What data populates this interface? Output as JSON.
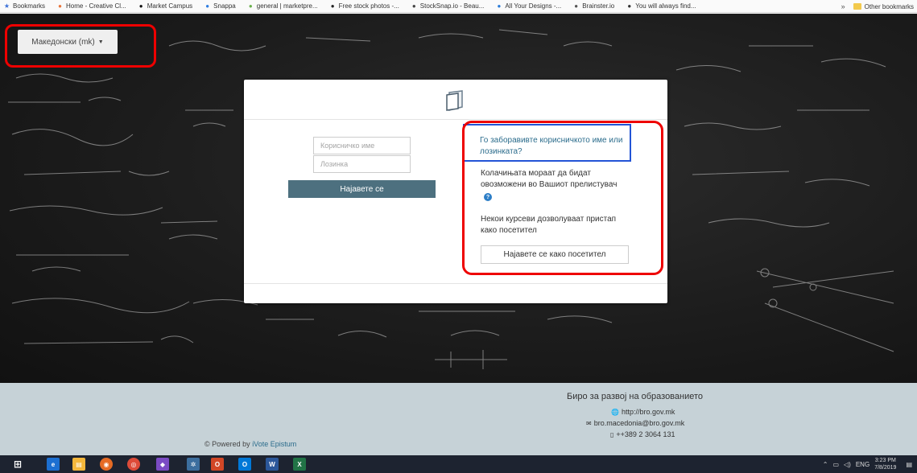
{
  "bookmarks": {
    "items": [
      {
        "label": "Bookmarks",
        "icon": "star-icon",
        "color": "#3a6fd8"
      },
      {
        "label": "Home - Creative Cl...",
        "icon": "creative-icon",
        "color": "#e8743b"
      },
      {
        "label": "Market Campus",
        "icon": "market-icon",
        "color": "#111111"
      },
      {
        "label": "Snappa",
        "icon": "snappa-icon",
        "color": "#2f7de1"
      },
      {
        "label": "general | marketpre...",
        "icon": "slack-icon",
        "color": "#6ab04c"
      },
      {
        "label": "Free stock photos -...",
        "icon": "pexels-icon",
        "color": "#222222"
      },
      {
        "label": "StockSnap.io - Beau...",
        "icon": "camera-icon",
        "color": "#444444"
      },
      {
        "label": "All Your Designs -...",
        "icon": "canva-icon",
        "color": "#2a7bd8"
      },
      {
        "label": "Brainster.io",
        "icon": "brainster-icon",
        "color": "#555555"
      },
      {
        "label": "You will always find...",
        "icon": "page-icon",
        "color": "#333333"
      }
    ],
    "overflow": "»",
    "other": "Other bookmarks"
  },
  "lang": {
    "label": "Македонски (mk)"
  },
  "login": {
    "username_placeholder": "Корисничко име",
    "password_placeholder": "Лозинка",
    "login_button": "Најавете се",
    "forgot_link": "Го заборавивте корисничкото име или лозинката?",
    "cookies_text": "Колачињата мораат да бидат овозможени во Вашиот прелистувач",
    "guest_text": "Некои курсеви дозволуваат пристап како посетител",
    "guest_button": "Најавете се како посетител"
  },
  "footer": {
    "title": "Биро за развој на образованието",
    "url": "http://bro.gov.mk",
    "email": "bro.macedonia@bro.gov.mk",
    "phone": "++389 2 3064 131",
    "powered_prefix": "© Powered by",
    "powered_link": "iVote Epistum"
  },
  "taskbar": {
    "lang": "ENG",
    "time": "3:23 PM",
    "date": "7/8/2019"
  }
}
